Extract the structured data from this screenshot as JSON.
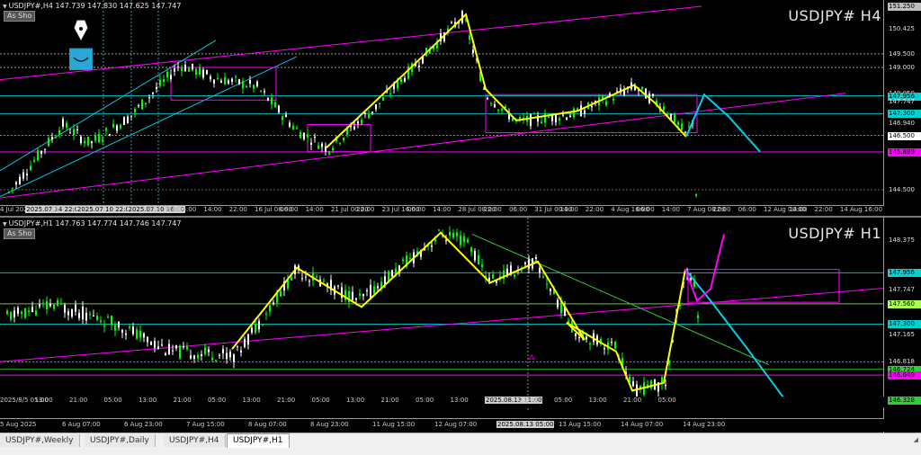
{
  "top_chart": {
    "header": "USDJPY#,H4  147.739 147.830 147.625 147.747",
    "button": "As Sho",
    "symbol": "USDJPY# H4",
    "prices": [
      {
        "v": "151.250",
        "bg": "#bdbdbd"
      },
      {
        "v": "150.425",
        "bg": ""
      },
      {
        "v": "149.500",
        "bg": ""
      },
      {
        "v": "149.000",
        "bg": ""
      },
      {
        "v": "148.050",
        "bg": ""
      },
      {
        "v": "147.956",
        "bg": "#00d2d2"
      },
      {
        "v": "147.747",
        "bg": ""
      },
      {
        "v": "147.300",
        "bg": "#00d2d2"
      },
      {
        "v": "146.940",
        "bg": ""
      },
      {
        "v": "146.500",
        "bg": "#ffffff"
      },
      {
        "v": "145.889",
        "bg": "#ff00ff"
      },
      {
        "v": "144.500",
        "bg": ""
      }
    ],
    "times": [
      {
        "t": "4 Jul 2025",
        "hl": false
      },
      {
        "t": "2025.07.14 22:00",
        "hl": true
      },
      {
        "t": "06:",
        "hl": false
      },
      {
        "t": "2025.07.10 22:00",
        "hl": true
      },
      {
        "t": "9 J",
        "hl": false
      },
      {
        "t": "2025.07.10 16:00",
        "hl": true
      },
      {
        "t": "Jul 16:00",
        "hl": false
      },
      {
        "t": "06:00",
        "hl": false
      },
      {
        "t": "14:00",
        "hl": false
      },
      {
        "t": "22:00",
        "hl": false
      },
      {
        "t": "16 Jul 08:00",
        "hl": false
      },
      {
        "t": "06:00",
        "hl": false
      },
      {
        "t": "14:00",
        "hl": false
      },
      {
        "t": "21 Jul 00:00",
        "hl": false
      },
      {
        "t": "22:00",
        "hl": false
      },
      {
        "t": "23 Jul 16:00",
        "hl": false
      },
      {
        "t": "06:00",
        "hl": false
      },
      {
        "t": "14:00",
        "hl": false
      },
      {
        "t": "28 Jul 08:00",
        "hl": false
      },
      {
        "t": "22:00",
        "hl": false
      },
      {
        "t": "06:00",
        "hl": false
      },
      {
        "t": "31 Jul 00:00",
        "hl": false
      },
      {
        "t": "14:00",
        "hl": false
      },
      {
        "t": "22:00",
        "hl": false
      },
      {
        "t": "4 Aug 16:00",
        "hl": false
      },
      {
        "t": "06:00",
        "hl": false
      },
      {
        "t": "14:00",
        "hl": false
      },
      {
        "t": "7 Aug 08:00",
        "hl": false
      },
      {
        "t": "22:00",
        "hl": false
      },
      {
        "t": "06:00",
        "hl": false
      },
      {
        "t": "12 Aug 00:00",
        "hl": false
      },
      {
        "t": "14:00",
        "hl": false
      },
      {
        "t": "22:00",
        "hl": false
      },
      {
        "t": "14 Aug 16:00",
        "hl": false
      }
    ]
  },
  "bottom_chart": {
    "header": "USDJPY#,H1  147.763 147.774 147.746 147.747",
    "button": "As Sho",
    "symbol": "USDJPY# H1",
    "prices": [
      {
        "v": "148.375",
        "bg": ""
      },
      {
        "v": "147.956",
        "bg": "#00d2d2"
      },
      {
        "v": "147.747",
        "bg": ""
      },
      {
        "v": "147.560",
        "bg": "#aaff55"
      },
      {
        "v": "147.300",
        "bg": "#00d2d2"
      },
      {
        "v": "147.165",
        "bg": ""
      },
      {
        "v": "146.818",
        "bg": ""
      },
      {
        "v": "146.724",
        "bg": "#33cc33"
      },
      {
        "v": "146.649",
        "bg": "#ff00ff"
      },
      {
        "v": "146.328",
        "bg": "#33cc33"
      }
    ],
    "times": [
      {
        "t": "2025/8/5 05:00",
        "hl": false
      },
      {
        "t": "13:00",
        "hl": false
      },
      {
        "t": "21:00",
        "hl": false
      },
      {
        "t": "05:00",
        "hl": false
      },
      {
        "t": "13:00",
        "hl": false
      },
      {
        "t": "21:00",
        "hl": false
      },
      {
        "t": "05:00",
        "hl": false
      },
      {
        "t": "13:00",
        "hl": false
      },
      {
        "t": "21:00",
        "hl": false
      },
      {
        "t": "05:00",
        "hl": false
      },
      {
        "t": "13:00",
        "hl": false
      },
      {
        "t": "21:00",
        "hl": false
      },
      {
        "t": "05:00",
        "hl": false
      },
      {
        "t": "13:00",
        "hl": false
      },
      {
        "t": "2025.08.13 11:00",
        "hl": true
      },
      {
        "t": "21:00",
        "hl": false
      },
      {
        "t": "05:00",
        "hl": false
      },
      {
        "t": "13:00",
        "hl": false
      },
      {
        "t": "21:00",
        "hl": false
      },
      {
        "t": "05:00",
        "hl": false
      }
    ],
    "dates": [
      {
        "t": "5 Aug 2025",
        "hl": false
      },
      {
        "t": "6 Aug 07:00",
        "hl": false
      },
      {
        "t": "6 Aug 23:00",
        "hl": false
      },
      {
        "t": "7 Aug 15:00",
        "hl": false
      },
      {
        "t": "8 Aug 07:00",
        "hl": false
      },
      {
        "t": "8 Aug 23:00",
        "hl": false
      },
      {
        "t": "11 Aug 15:00",
        "hl": false
      },
      {
        "t": "12 Aug 07:00",
        "hl": false
      },
      {
        "t": "2025.08.13 05:00",
        "hl": true
      },
      {
        "t": "13 Aug 15:00",
        "hl": false
      },
      {
        "t": "14 Aug 07:00",
        "hl": false
      },
      {
        "t": "14 Aug 23:00",
        "hl": false
      }
    ]
  },
  "tabs": [
    {
      "label": "USDJPY#,Weekly",
      "active": false
    },
    {
      "label": "USDJPY#,Daily",
      "active": false
    },
    {
      "label": "USDJPY#,H4",
      "active": false
    },
    {
      "label": "USDJPY#,H1",
      "active": true
    }
  ],
  "colors": {
    "bull": "#00ff00",
    "bear": "#ffffff",
    "zigzag": "#ffff00",
    "trend": "#ff00ff",
    "channel": "#00c8e0",
    "projection": "#00d0e8",
    "grid": "#9aa0a0",
    "hline_cyan": "#00b4b4",
    "hline_green": "#22aa22"
  },
  "icons": {
    "pen": "pen-nib-icon",
    "grip": "resize-grip-icon"
  }
}
